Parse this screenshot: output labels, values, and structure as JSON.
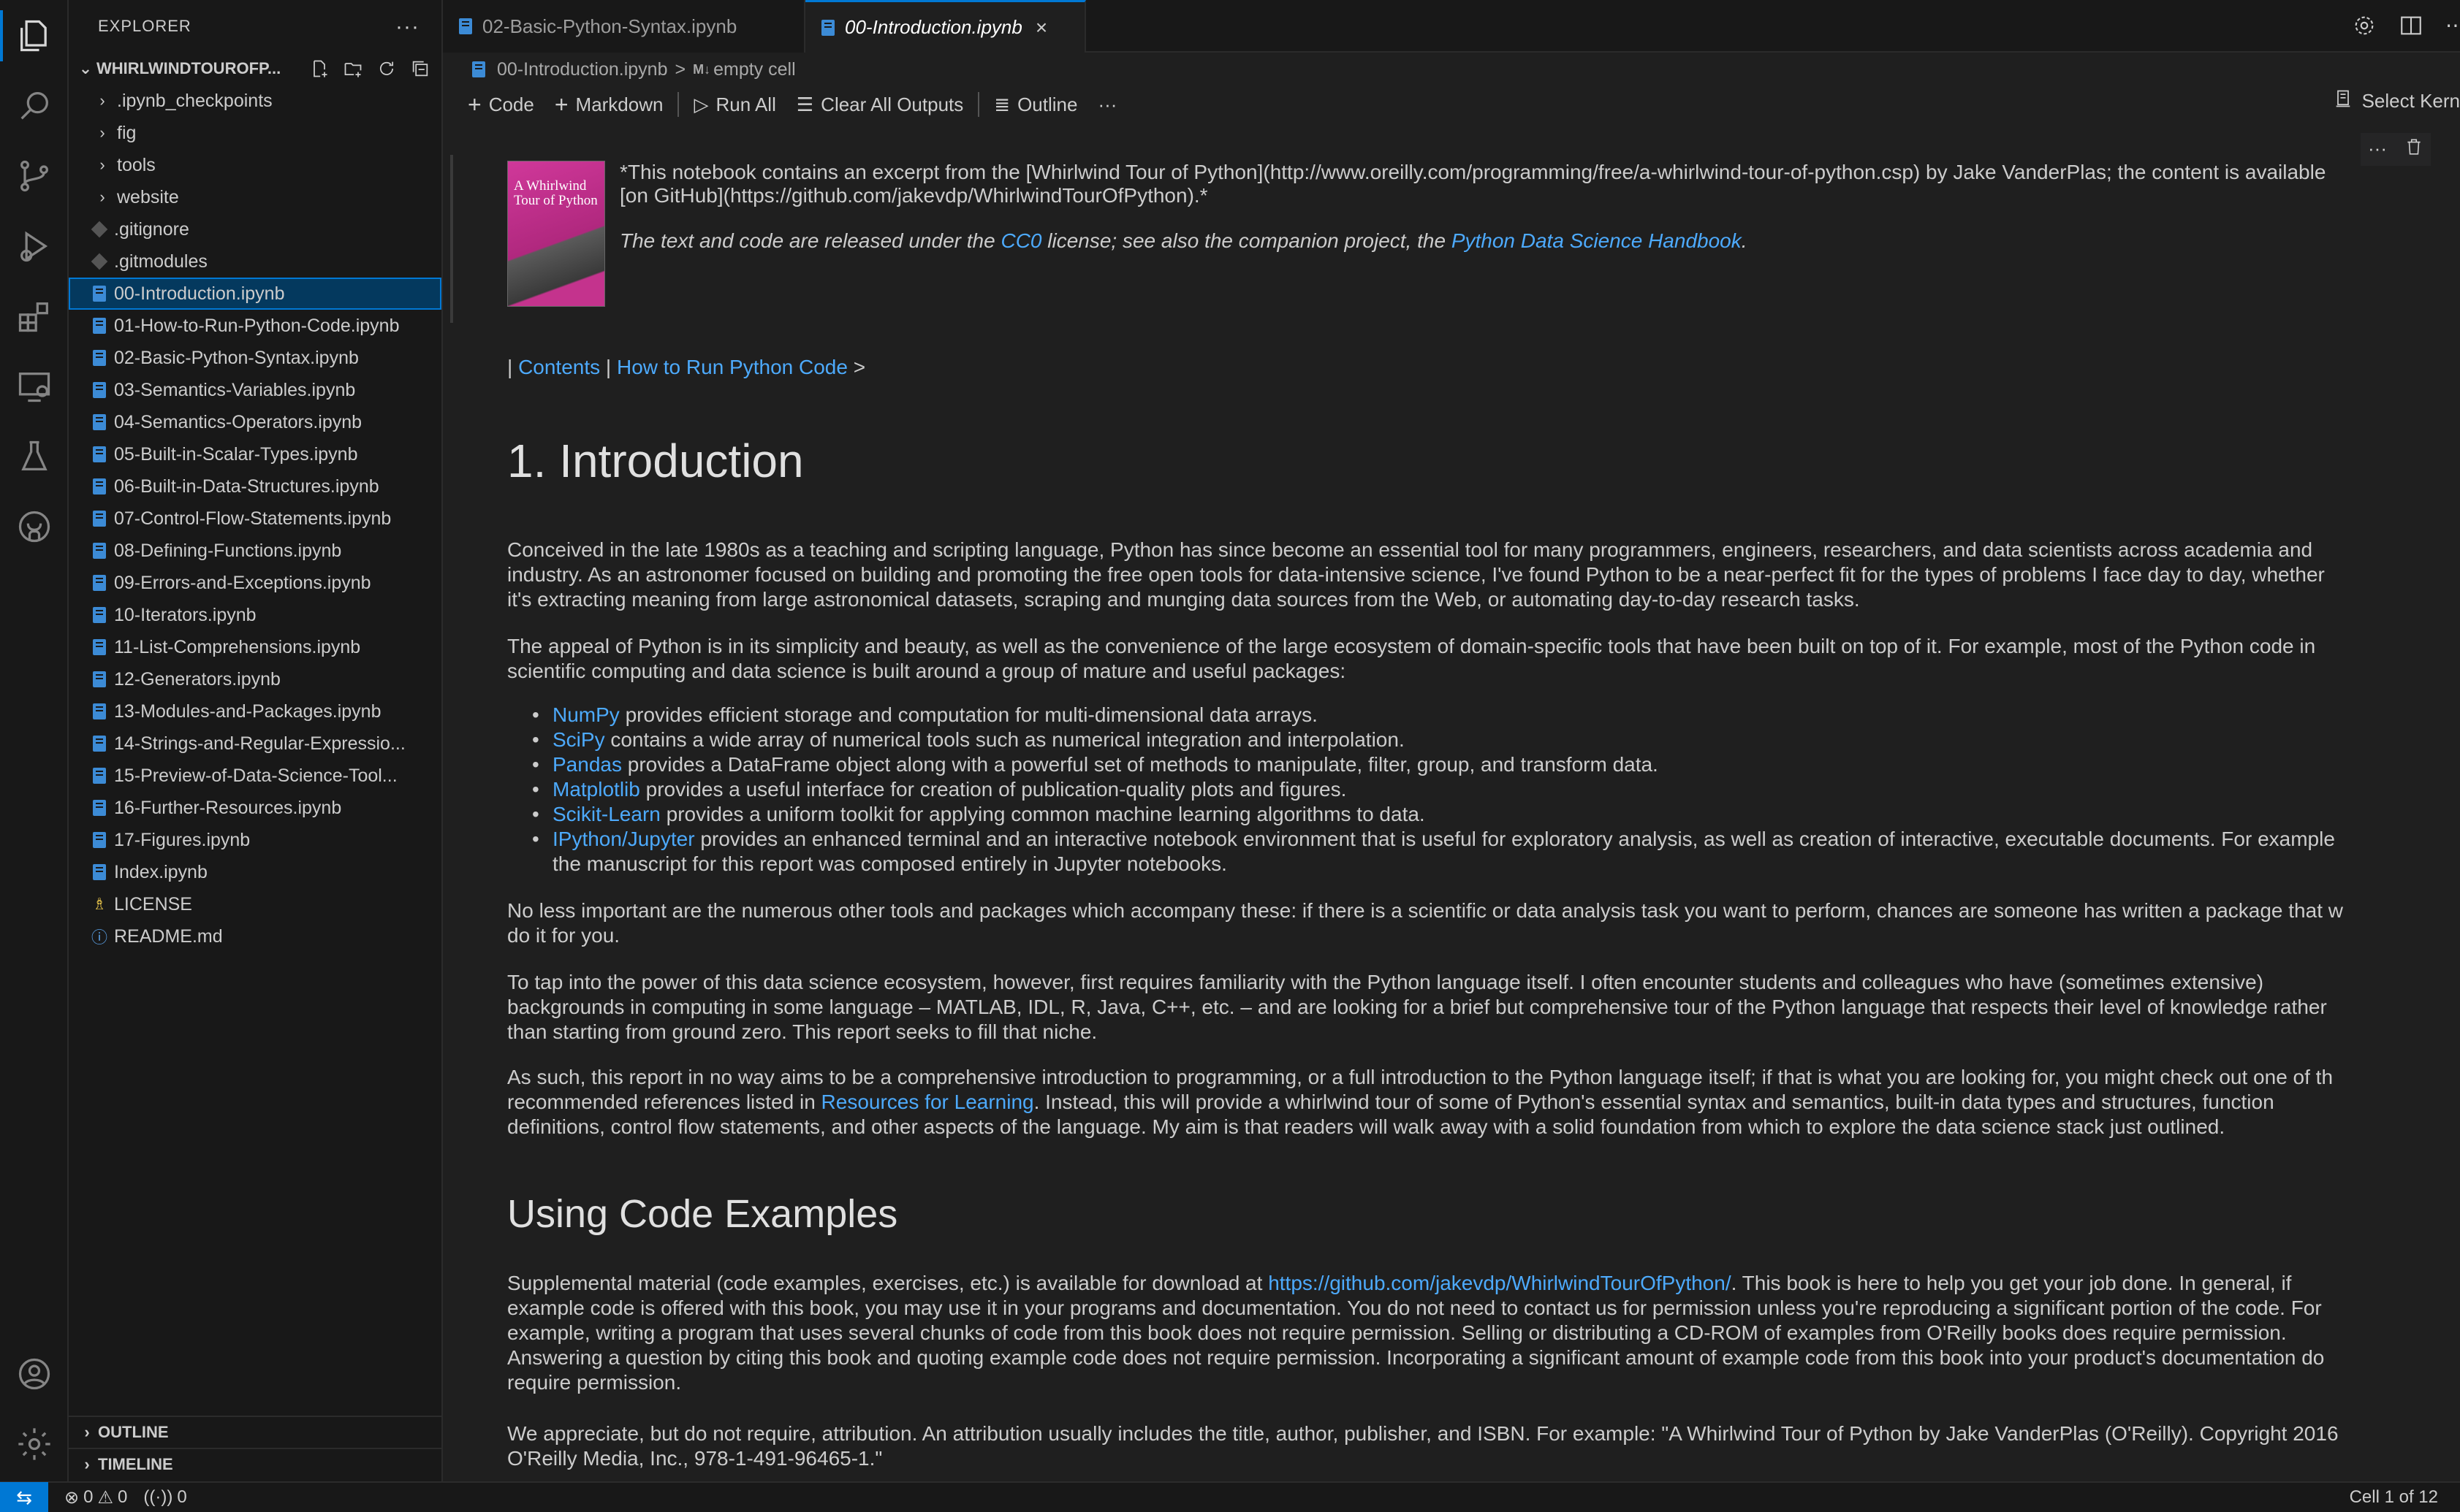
{
  "explorer": {
    "title": "EXPLORER",
    "more_label": "···",
    "folder_name": "WHIRLWINDTOUROFP...",
    "items": [
      {
        "label": ".ipynb_checkpoints",
        "type": "dir"
      },
      {
        "label": "fig",
        "type": "dir"
      },
      {
        "label": "tools",
        "type": "dir"
      },
      {
        "label": "website",
        "type": "dir"
      },
      {
        "label": ".gitignore",
        "type": "git"
      },
      {
        "label": ".gitmodules",
        "type": "git"
      },
      {
        "label": "00-Introduction.ipynb",
        "type": "notebook",
        "selected": true
      },
      {
        "label": "01-How-to-Run-Python-Code.ipynb",
        "type": "notebook"
      },
      {
        "label": "02-Basic-Python-Syntax.ipynb",
        "type": "notebook"
      },
      {
        "label": "03-Semantics-Variables.ipynb",
        "type": "notebook"
      },
      {
        "label": "04-Semantics-Operators.ipynb",
        "type": "notebook"
      },
      {
        "label": "05-Built-in-Scalar-Types.ipynb",
        "type": "notebook"
      },
      {
        "label": "06-Built-in-Data-Structures.ipynb",
        "type": "notebook"
      },
      {
        "label": "07-Control-Flow-Statements.ipynb",
        "type": "notebook"
      },
      {
        "label": "08-Defining-Functions.ipynb",
        "type": "notebook"
      },
      {
        "label": "09-Errors-and-Exceptions.ipynb",
        "type": "notebook"
      },
      {
        "label": "10-Iterators.ipynb",
        "type": "notebook"
      },
      {
        "label": "11-List-Comprehensions.ipynb",
        "type": "notebook"
      },
      {
        "label": "12-Generators.ipynb",
        "type": "notebook"
      },
      {
        "label": "13-Modules-and-Packages.ipynb",
        "type": "notebook"
      },
      {
        "label": "14-Strings-and-Regular-Expressio...",
        "type": "notebook"
      },
      {
        "label": "15-Preview-of-Data-Science-Tool...",
        "type": "notebook"
      },
      {
        "label": "16-Further-Resources.ipynb",
        "type": "notebook"
      },
      {
        "label": "17-Figures.ipynb",
        "type": "notebook"
      },
      {
        "label": "Index.ipynb",
        "type": "notebook"
      },
      {
        "label": "LICENSE",
        "type": "license"
      },
      {
        "label": "README.md",
        "type": "info"
      }
    ],
    "outline_label": "OUTLINE",
    "timeline_label": "TIMELINE"
  },
  "tabs": [
    {
      "label": "02-Basic-Python-Syntax.ipynb",
      "active": false
    },
    {
      "label": "00-Introduction.ipynb",
      "active": true,
      "close": "×"
    }
  ],
  "breadcrumb": {
    "file": "00-Introduction.ipynb",
    "separator": ">",
    "md_tag": "M↓",
    "cell": "empty cell"
  },
  "toolbar": {
    "code": "Code",
    "markdown": "Markdown",
    "run_all": "Run All",
    "clear_outputs": "Clear All Outputs",
    "outline": "Outline",
    "more": "···",
    "kernel": "Select Kern"
  },
  "cell_actions": {
    "more": "···"
  },
  "notebook": {
    "cover_title": "A Whirlwind Tour of Python",
    "intro_line1": "*This notebook contains an excerpt from the [Whirlwind Tour of Python](http://www.oreilly.com/programming/free/a-whirlwind-tour-of-python.csp) by Jake VanderPlas; the content is available",
    "intro_line2": "[on GitHub](https://github.com/jakevdp/WhirlwindTourOfPython).*",
    "license_pre": "The text and code are released under the ",
    "license_link": "CC0",
    "license_mid": " license; see also the companion project, the ",
    "license_link2": "Python Data Science Handbook",
    "license_post": ".",
    "nav_pre": "| ",
    "nav_contents": "Contents",
    "nav_sep": " | ",
    "nav_next": "How to Run Python Code",
    "nav_post": " >",
    "h1": "1. Introduction",
    "p1": [
      "Conceived in the late 1980s as a teaching and scripting language, Python has since become an essential tool for many programmers, engineers, researchers, and data scientists across academia and",
      "industry. As an astronomer focused on building and promoting the free open tools for data-intensive science, I've found Python to be a near-perfect fit for the types of problems I face day to day, whether",
      "it's extracting meaning from large astronomical datasets, scraping and munging data sources from the Web, or automating day-to-day research tasks."
    ],
    "p2": [
      "The appeal of Python is in its simplicity and beauty, as well as the convenience of the large ecosystem of domain-specific tools that have been built on top of it. For example, most of the Python code in",
      "scientific computing and data science is built around a group of mature and useful packages:"
    ],
    "bullets": [
      {
        "link": "NumPy",
        "text": " provides efficient storage and computation for multi-dimensional data arrays."
      },
      {
        "link": "SciPy",
        "text": " contains a wide array of numerical tools such as numerical integration and interpolation."
      },
      {
        "link": "Pandas",
        "text": " provides a DataFrame object along with a powerful set of methods to manipulate, filter, group, and transform data."
      },
      {
        "link": "Matplotlib",
        "text": " provides a useful interface for creation of publication-quality plots and figures."
      },
      {
        "link": "Scikit-Learn",
        "text": " provides a uniform toolkit for applying common machine learning algorithms to data."
      },
      {
        "link": "IPython/Jupyter",
        "text": " provides an enhanced terminal and an interactive notebook environment that is useful for exploratory analysis, as well as creation of interactive, executable documents. For example",
        "text2": "the manuscript for this report was composed entirely in Jupyter notebooks."
      }
    ],
    "p3": [
      "No less important are the numerous other tools and packages which accompany these: if there is a scientific or data analysis task you want to perform, chances are someone has written a package that w",
      "do it for you."
    ],
    "p4": [
      "To tap into the power of this data science ecosystem, however, first requires familiarity with the Python language itself. I often encounter students and colleagues who have (sometimes extensive)",
      "backgrounds in computing in some language – MATLAB, IDL, R, Java, C++, etc. – and are looking for a brief but comprehensive tour of the Python language that respects their level of knowledge rather",
      "than starting from ground zero. This report seeks to fill that niche."
    ],
    "p5_line1": "As such, this report in no way aims to be a comprehensive introduction to programming, or a full introduction to the Python language itself; if that is what you are looking for, you might check out one of th",
    "p5_line2_pre": "recommended references listed in ",
    "p5_line2_link": "Resources for Learning",
    "p5_line2_post": ". Instead, this will provide a whirlwind tour of some of Python's essential syntax and semantics, built-in data types and structures, function",
    "p5_line3": "definitions, control flow statements, and other aspects of the language. My aim is that readers will walk away with a solid foundation from which to explore the data science stack just outlined.",
    "h2": "Using Code Examples",
    "p6_line1_pre": "Supplemental material (code examples, exercises, etc.) is available for download at ",
    "p6_line1_link": "https://github.com/jakevdp/WhirlwindTourOfPython/",
    "p6_line1_post": ". This book is here to help you get your job done. In general, if",
    "p6_rest": [
      "example code is offered with this book, you may use it in your programs and documentation. You do not need to contact us for permission unless you're reproducing a significant portion of the code. For",
      "example, writing a program that uses several chunks of code from this book does not require permission. Selling or distributing a CD-ROM of examples from O'Reilly books does require permission.",
      "Answering a question by citing this book and quoting example code does not require permission. Incorporating a significant amount of example code from this book into your product's documentation do",
      "require permission."
    ],
    "p7": [
      "We appreciate, but do not require, attribution. An attribution usually includes the title, author, publisher, and ISBN. For example: \"A Whirlwind Tour of Python by Jake VanderPlas (O'Reilly). Copyright 2016",
      "O'Reilly Media, Inc., 978-1-491-96465-1.\""
    ]
  },
  "statusbar": {
    "errors": "0",
    "warnings": "0",
    "ports": "0",
    "cell_position": "Cell 1 of 12"
  },
  "colors": {
    "accent": "#0078d4",
    "link": "#4daafc",
    "selection": "#04395e"
  }
}
